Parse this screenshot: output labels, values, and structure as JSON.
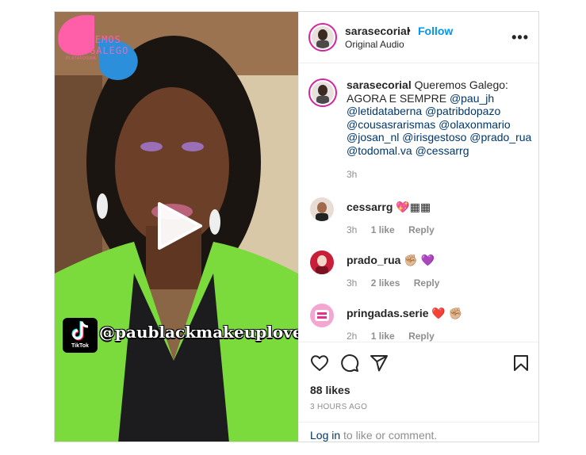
{
  "video": {
    "logo_text_line1": "QUEREMOS",
    "logo_text_line2": "GALEGO",
    "logo_subtext": "PLATAFORMA",
    "tiktok_label": "TikTok",
    "tiktok_handle": "@paublackmakeuplover",
    "colors": {
      "logo_pink": "#ff5fa8",
      "logo_blue": "#2b8fdc",
      "jacket": "#7cdb3c"
    }
  },
  "header": {
    "username": "sarasecorial",
    "separator": "•",
    "follow_label": "Follow",
    "audio": "Original Audio",
    "more_icon": "ellipsis-icon"
  },
  "caption": {
    "username": "sarasecorial",
    "text": "Queremos Galego: AGORA E SEMPRE",
    "mentions": [
      "@pau_jh",
      "@letidataberna",
      "@patribdopazo",
      "@cousasrarismas",
      "@olaxonmario",
      "@josan_nl",
      "@irisgestoso",
      "@prado_rua",
      "@todomal.va",
      "@cessarrg"
    ],
    "time": "3h"
  },
  "comments": [
    {
      "username": "cessarrg",
      "emoji": "💖▦▦",
      "time": "3h",
      "likes": "1 like",
      "reply": "Reply"
    },
    {
      "username": "prado_rua",
      "emoji": "✊🏼 💜",
      "time": "3h",
      "likes": "2 likes",
      "reply": "Reply"
    },
    {
      "username": "pringadas.serie",
      "emoji": "❤️ ✊🏼",
      "time": "2h",
      "likes": "1 like",
      "reply": "Reply"
    }
  ],
  "actions": {
    "icons": [
      "heart-icon",
      "comment-icon",
      "share-icon",
      "bookmark-icon"
    ],
    "likes": "88 likes",
    "time_ago": "3 HOURS AGO",
    "login_link": "Log in",
    "login_rest": "to like or comment."
  }
}
